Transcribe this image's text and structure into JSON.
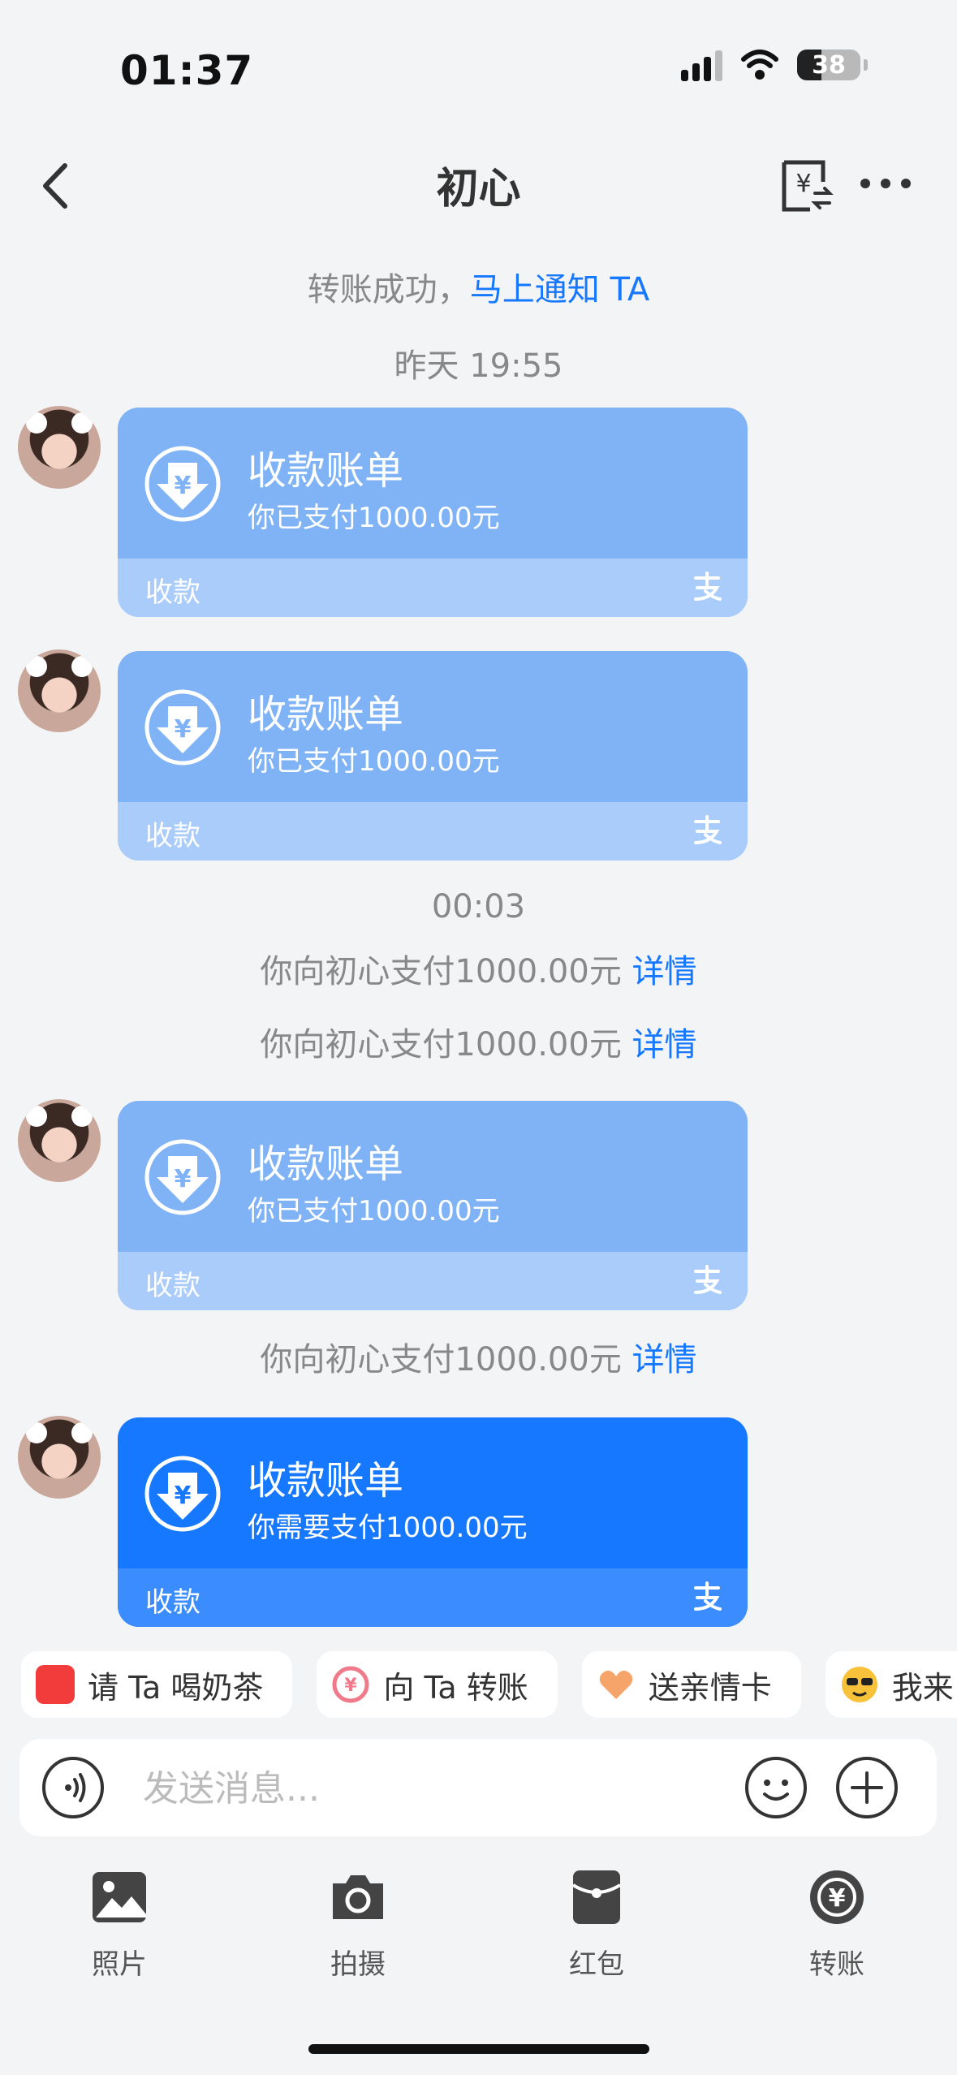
{
  "status": {
    "time": "01:37",
    "battery": "38"
  },
  "nav": {
    "title": "初心"
  },
  "notice": {
    "text": "转账成功，",
    "link": "马上通知 TA"
  },
  "times": {
    "t1": "昨天 19:55",
    "t2": "00:03"
  },
  "cards": [
    {
      "title": "收款账单",
      "sub": "你已支付1000.00元",
      "footer": "收款"
    },
    {
      "title": "收款账单",
      "sub": "你已支付1000.00元",
      "footer": "收款"
    },
    {
      "title": "收款账单",
      "sub": "你已支付1000.00元",
      "footer": "收款"
    },
    {
      "title": "收款账单",
      "sub": "你需要支付1000.00元",
      "footer": "收款"
    }
  ],
  "payments": [
    {
      "text": "你向初心支付1000.00元",
      "link": "详情"
    },
    {
      "text": "你向初心支付1000.00元",
      "link": "详情"
    },
    {
      "text": "你向初心支付1000.00元",
      "link": "详情"
    }
  ],
  "chips": [
    "请 Ta 喝奶茶",
    "向 Ta 转账",
    "送亲情卡",
    "我来"
  ],
  "input": {
    "placeholder": "发送消息..."
  },
  "toolbar": [
    "照片",
    "拍摄",
    "红包",
    "转账"
  ],
  "colors": {
    "accent": "#1677ff",
    "card_paid": "#7fb3f6",
    "card_active": "#1677ff"
  }
}
